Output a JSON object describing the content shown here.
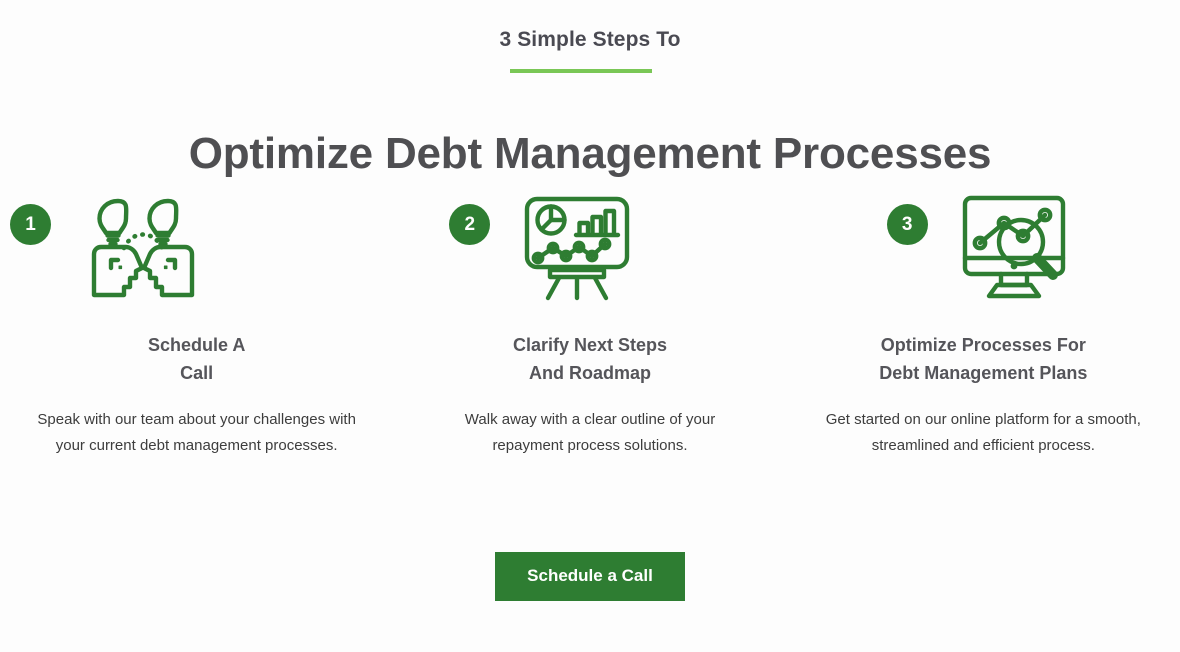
{
  "header": {
    "eyebrow": "3 Simple Steps To",
    "title": "Optimize Debt Management Processes",
    "accent_color": "#7ac756"
  },
  "theme": {
    "brand_green": "#2e7d32",
    "accent_green": "#7ac756",
    "heading_color": "#4f4f52",
    "body_color": "#3d3d3d",
    "background": "#fdfdfd"
  },
  "steps": [
    {
      "number": "1",
      "icon": "two-heads-lightbulbs-icon",
      "title_line1": "Schedule A",
      "title_line2": "Call",
      "body": "Speak with our team about your challenges with your current debt management processes."
    },
    {
      "number": "2",
      "icon": "presentation-board-charts-icon",
      "title_line1": "Clarify Next Steps",
      "title_line2": "And Roadmap",
      "body": "Walk away with a clear outline of your repayment process solutions."
    },
    {
      "number": "3",
      "icon": "monitor-analytics-magnifier-icon",
      "title_line1": "Optimize Processes For",
      "title_line2": "Debt Management Plans",
      "body": "Get started on our online platform for a smooth, streamlined and efficient process."
    }
  ],
  "cta": {
    "label": "Schedule a Call"
  }
}
